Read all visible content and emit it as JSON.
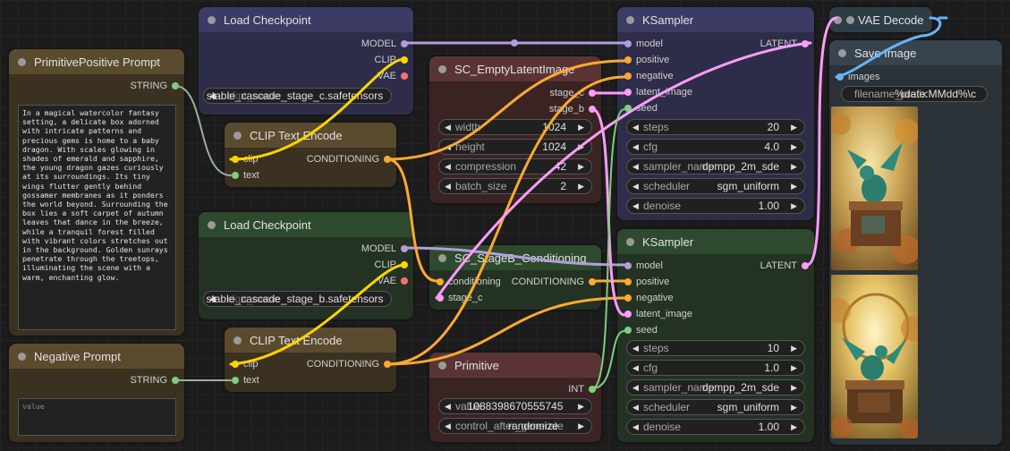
{
  "colors": {
    "model": "#b39ddb",
    "clip": "#ffd500",
    "vae": "#ff6e6e",
    "conditioning": "#ffa931",
    "latent": "#ff9cf9",
    "string": "#7ecf7e",
    "int": "#7ecf7e",
    "image": "#64b5f6"
  },
  "prompt_pos": {
    "title": "PrimitivePositive Prompt",
    "output": "STRING",
    "text": "In a magical watercolor fantasy setting, a delicate box adorned with intricate patterns and precious gems is home to a baby dragon. With scales glowing in shades of emerald and sapphire, the young dragon gazes curiously at its surroundings. Its tiny wings flutter gently behind gossamer membranes as it ponders the world beyond. Surrounding the box lies a soft carpet of autumn leaves that dance in the breeze, while a tranquil forest filled with vibrant colors stretches out in the background. Golden sunrays penetrate through the treetops, illuminating the scene with a warm, enchanting glow."
  },
  "prompt_neg": {
    "title": "Negative Prompt",
    "output": "STRING",
    "placeholder": "value"
  },
  "ckpt_c": {
    "title": "Load Checkpoint",
    "out_model": "MODEL",
    "out_clip": "CLIP",
    "out_vae": "VAE",
    "widget_label": "ckpt_name",
    "widget_value": "stable_cascade_stage_c.safetensors"
  },
  "ckpt_b": {
    "title": "Load Checkpoint",
    "out_model": "MODEL",
    "out_clip": "CLIP",
    "out_vae": "VAE",
    "widget_label": "ckpt_name",
    "widget_value": "stable_cascade_stage_b.safetensors"
  },
  "clip_pos": {
    "title": "CLIP Text Encode",
    "in_clip": "clip",
    "in_text": "text",
    "output": "CONDITIONING"
  },
  "clip_neg": {
    "title": "CLIP Text Encode",
    "in_clip": "clip",
    "in_text": "text",
    "output": "CONDITIONING"
  },
  "latent": {
    "title": "SC_EmptyLatentImage",
    "out_c": "stage_c",
    "out_b": "stage_b",
    "widgets": [
      {
        "label": "width",
        "value": "1024"
      },
      {
        "label": "height",
        "value": "1024"
      },
      {
        "label": "compression",
        "value": "42"
      },
      {
        "label": "batch_size",
        "value": "2"
      }
    ]
  },
  "stageb": {
    "title": "SC_StageB_Conditioning",
    "in_cond": "conditioning",
    "in_stagec": "stage_c",
    "output": "CONDITIONING"
  },
  "primitive": {
    "title": "Primitive",
    "output": "INT",
    "widgets": [
      {
        "label": "value",
        "value": "1088398670555745"
      },
      {
        "label": "control_after_generate",
        "value": "randomize"
      }
    ]
  },
  "ks1": {
    "title": "KSampler",
    "inputs": [
      "model",
      "positive",
      "negative",
      "latent_image",
      "seed"
    ],
    "output": "LATENT",
    "widgets": [
      {
        "label": "steps",
        "value": "20"
      },
      {
        "label": "cfg",
        "value": "4.0"
      },
      {
        "label": "sampler_name",
        "value": "dpmpp_2m_sde"
      },
      {
        "label": "scheduler",
        "value": "sgm_uniform"
      },
      {
        "label": "denoise",
        "value": "1.00"
      }
    ]
  },
  "ks2": {
    "title": "KSampler",
    "inputs": [
      "model",
      "positive",
      "negative",
      "latent_image",
      "seed"
    ],
    "output": "LATENT",
    "widgets": [
      {
        "label": "steps",
        "value": "10"
      },
      {
        "label": "cfg",
        "value": "1.0"
      },
      {
        "label": "sampler_name",
        "value": "dpmpp_2m_sde"
      },
      {
        "label": "scheduler",
        "value": "sgm_uniform"
      },
      {
        "label": "denoise",
        "value": "1.00"
      }
    ]
  },
  "vae_decode": {
    "title": "VAE Decode"
  },
  "save_image": {
    "title": "Save Image",
    "in_images": "images",
    "widget_label": "filename_prefix",
    "widget_value": "%date:MMdd%\\c"
  }
}
